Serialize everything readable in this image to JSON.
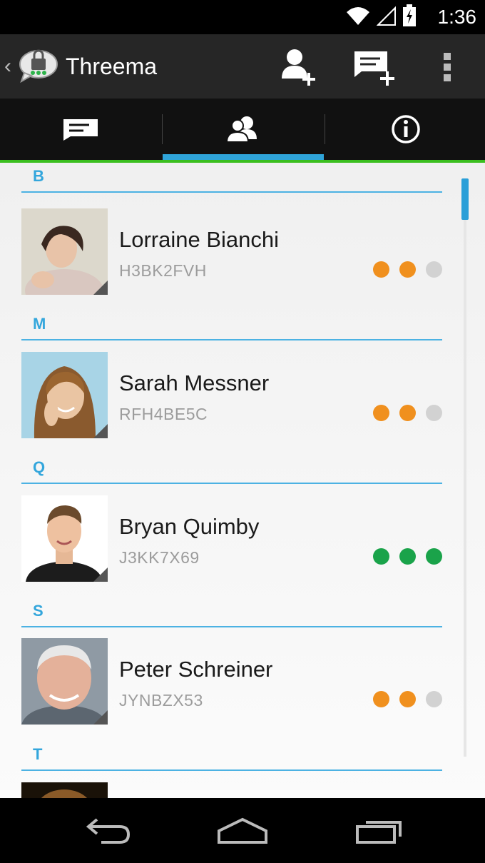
{
  "status_bar": {
    "time": "1:36",
    "icons": [
      "wifi-icon",
      "signal-icon",
      "battery-charging-icon"
    ]
  },
  "action_bar": {
    "title": "Threema",
    "logo": "threema-logo-icon",
    "actions": [
      "add-contact-icon",
      "new-message-icon",
      "overflow-menu-icon"
    ]
  },
  "tabs": [
    {
      "icon": "conversations-icon",
      "selected": false
    },
    {
      "icon": "contacts-icon",
      "selected": true
    },
    {
      "icon": "info-icon",
      "selected": false
    }
  ],
  "contacts_list": {
    "sections": [
      {
        "letter": "B",
        "contacts": [
          {
            "name": "Lorraine Bianchi",
            "id": "H3BK2FVH",
            "verification": [
              "orange",
              "orange",
              "gray"
            ]
          }
        ]
      },
      {
        "letter": "M",
        "contacts": [
          {
            "name": "Sarah Messner",
            "id": "RFH4BE5C",
            "verification": [
              "orange",
              "orange",
              "gray"
            ]
          }
        ]
      },
      {
        "letter": "Q",
        "contacts": [
          {
            "name": "Bryan Quimby",
            "id": "J3KK7X69",
            "verification": [
              "green",
              "green",
              "green"
            ]
          }
        ]
      },
      {
        "letter": "S",
        "contacts": [
          {
            "name": "Peter Schreiner",
            "id": "JYNBZX53",
            "verification": [
              "orange",
              "orange",
              "gray"
            ]
          }
        ]
      },
      {
        "letter": "T",
        "contacts": []
      }
    ]
  },
  "colors": {
    "accent": "#2fa4d9",
    "green_bar": "#3bbf1f",
    "orange": "#f0901e",
    "green": "#1aa34a",
    "gray": "#d2d2d2"
  },
  "nav_bar": [
    "back-icon",
    "home-icon",
    "recents-icon"
  ]
}
